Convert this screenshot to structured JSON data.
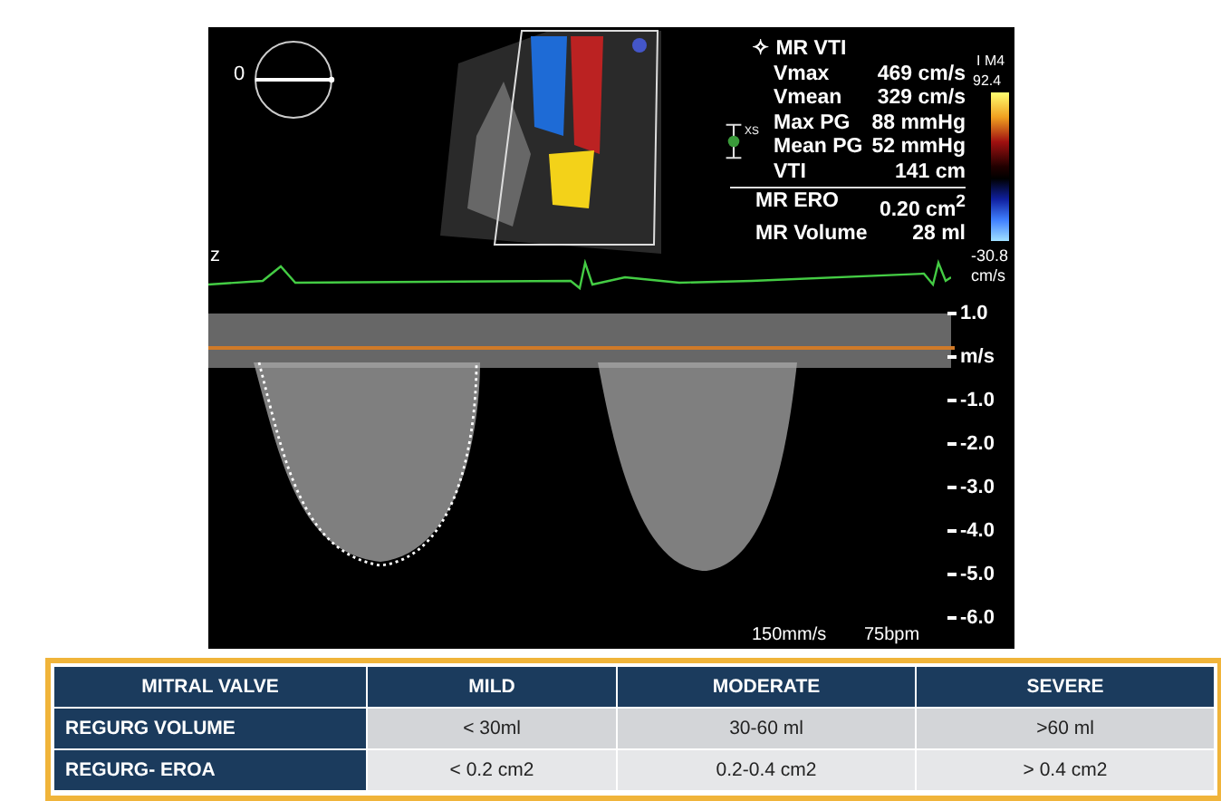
{
  "ultrasound": {
    "angle_label": "0",
    "cut_label": "z",
    "probe_marker": "xs",
    "measurements": {
      "title": "✧ MR VTI",
      "rows": [
        {
          "label": "Vmax",
          "value": "469 cm/s"
        },
        {
          "label": "Vmean",
          "value": "329 cm/s"
        },
        {
          "label": "Max PG",
          "value": "88 mmHg"
        },
        {
          "label": "Mean PG",
          "value": "52 mmHg"
        },
        {
          "label": "VTI",
          "value": "141 cm"
        }
      ],
      "results": [
        {
          "label": "MR ERO",
          "value": "0.20 cm$^{2}$"
        },
        {
          "label": "MR Volume",
          "value": "28 ml"
        }
      ]
    },
    "color_scale": {
      "mode": "I M4",
      "max": "92.4",
      "min": "-30.8",
      "unit": "cm/s"
    },
    "velocity_scale": [
      "1.0",
      "m/s",
      "-1.0",
      "-2.0",
      "-3.0",
      "-4.0",
      "-5.0",
      "-6.0"
    ],
    "sweep_speed": "150mm/s",
    "heart_rate": "75bpm"
  },
  "table": {
    "columns": [
      "MITRAL VALVE",
      "MILD",
      "MODERATE",
      "SEVERE"
    ],
    "rows": [
      [
        "REGURG VOLUME",
        "< 30ml",
        "30-60 ml",
        ">60 ml"
      ],
      [
        "REGURG- EROA",
        "< 0.2 cm2",
        "0.2-0.4 cm2",
        "> 0.4 cm2"
      ]
    ]
  }
}
